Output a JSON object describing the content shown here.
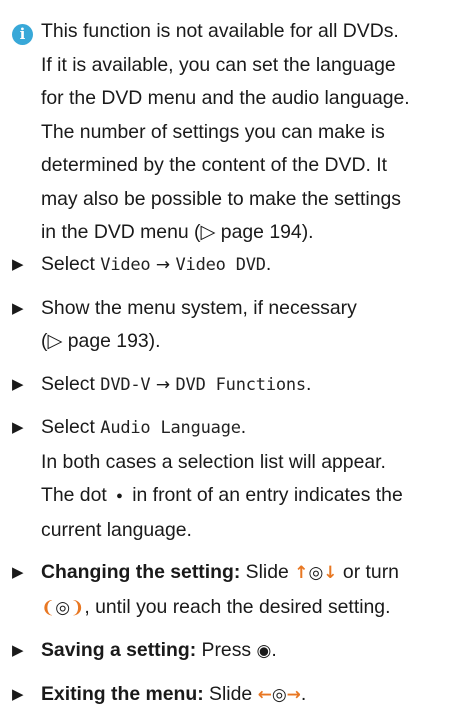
{
  "note": {
    "icon": "info-icon",
    "line1": "This function is not available for all DVDs.",
    "line2": "If it is available, you can set the language",
    "line3": "for the DVD menu and the audio language.",
    "line4": "The number of settings you can make is",
    "line5": "determined by the content of the DVD. It",
    "line6": "may also be possible to make the settings",
    "line7a": "in the DVD menu (",
    "line7ref": "▷ page 194",
    "line7b": ")."
  },
  "steps": [
    {
      "text": "Select ",
      "code1": "Video",
      "arrow": "→",
      "code2": "Video DVD",
      "end": "."
    },
    {
      "line1": "Show the menu system, if necessary",
      "ref": "(▷ page 193)."
    },
    {
      "text": "Select ",
      "code1": "DVD-V",
      "arrow": "→",
      "code2": "DVD Functions",
      "end": "."
    },
    {
      "text": "Select ",
      "code1": "Audio Language",
      "end": ".",
      "line2": "In both cases a selection list will appear.",
      "line3a": "The dot ",
      "dot": "●",
      "line3b": " in front of an entry indicates the",
      "line4": "current language."
    },
    {
      "label": "Changing the setting:",
      "t1": " Slide ",
      "ctrl1": "↑◎↓",
      "t2": " or turn",
      "ctrl2": "❨◎❩",
      "t3": ", until you reach the desired setting."
    },
    {
      "label": "Saving a setting:",
      "t1": " Press ",
      "ctrl1": "◉",
      "t2": "."
    },
    {
      "label": "Exiting the menu:",
      "t1": " Slide ",
      "ctrl1": "←◎→",
      "t2": "."
    }
  ]
}
